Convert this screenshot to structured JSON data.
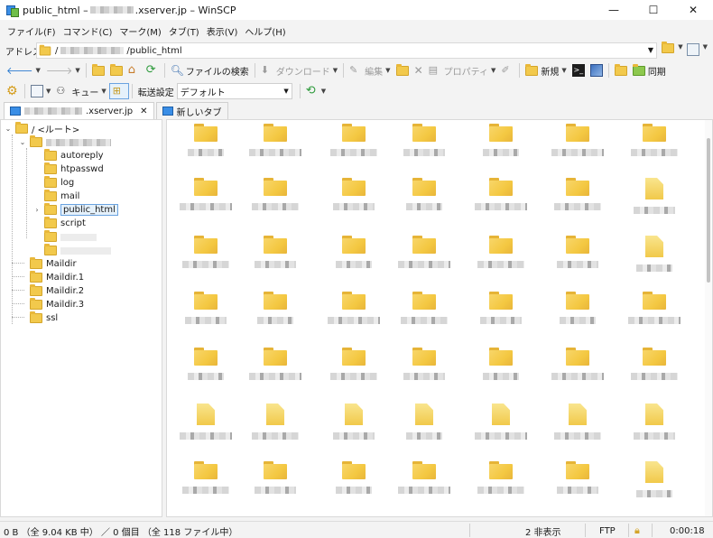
{
  "window": {
    "title_prefix": "public_html –",
    "title_suffix": ".xserver.jp – WinSCP",
    "minimize": "—",
    "maximize": "☐",
    "close": "✕"
  },
  "menu": [
    "ファイル(F)",
    "コマンド(C)",
    "マーク(M)",
    "タブ(T)",
    "表示(V)",
    "ヘルプ(H)"
  ],
  "address": {
    "label": "アドレス",
    "path_prefix": "/",
    "path_suffix": "/public_html"
  },
  "toolbar1": {
    "find_files": "ファイルの検索",
    "download": "ダウンロード",
    "edit": "編集",
    "properties": "プロパティ",
    "new": "新規",
    "sync": "同期"
  },
  "toolbar2": {
    "queue": "キュー",
    "transfer_label": "転送設定",
    "transfer_value": "デフォルト"
  },
  "tabs": {
    "session_suffix": ".xserver.jp",
    "new_tab": "新しいタブ"
  },
  "tree": {
    "root": "/ <ルート>",
    "children": [
      "autoreply",
      "htpasswd",
      "log",
      "mail",
      "public_html",
      "script"
    ],
    "top_level": [
      "Maildir",
      "Maildir.1",
      "Maildir.2",
      "Maildir.3",
      "ssl"
    ]
  },
  "status": {
    "selection": "0 B （全 9.04 KB 中） ／ 0 個目 （全 118 ファイル中）",
    "hidden": "2 非表示",
    "protocol": "FTP",
    "elapsed": "0:00:18"
  }
}
